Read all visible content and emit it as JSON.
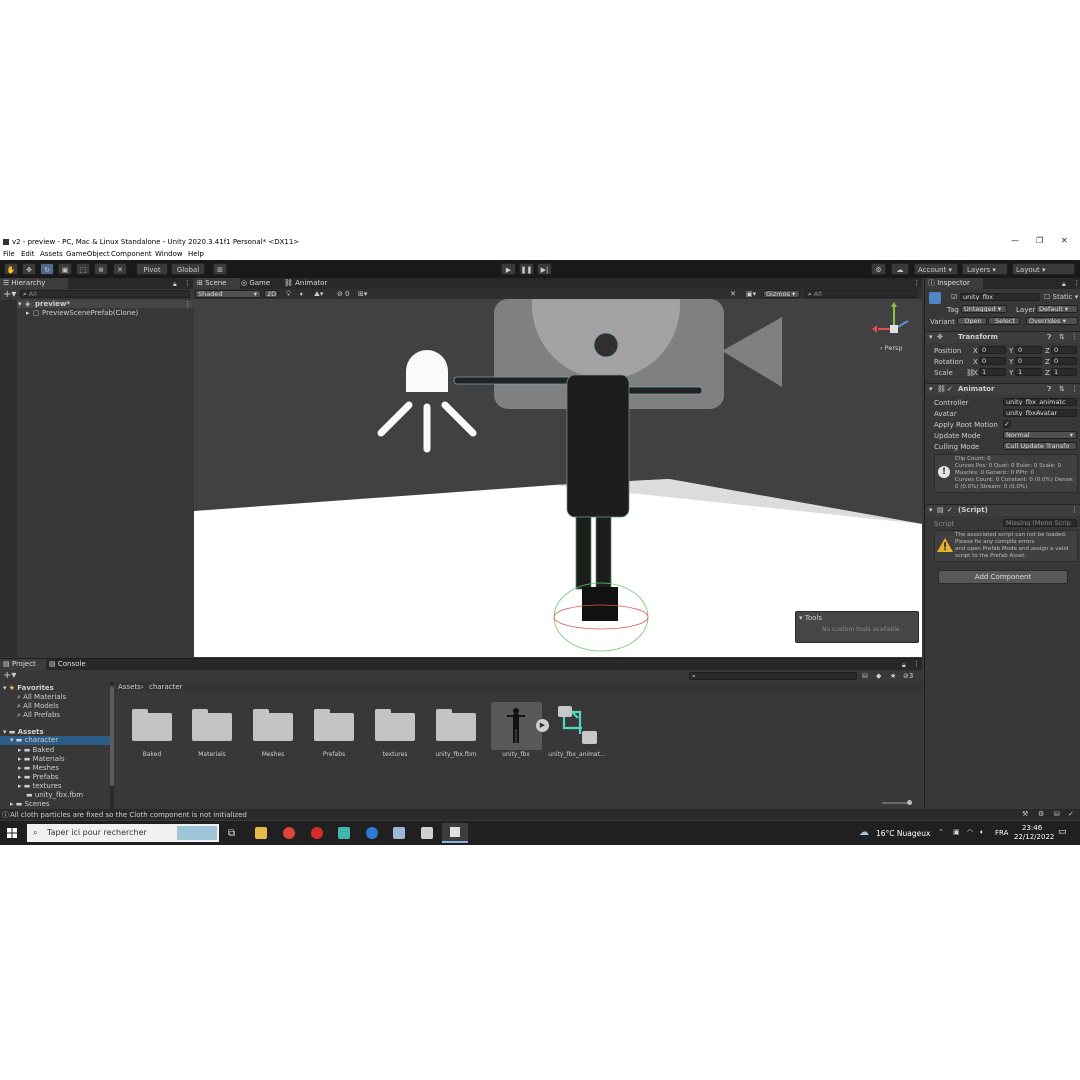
{
  "window": {
    "title": "v2 - preview - PC, Mac & Linux Standalone - Unity 2020.3.41f1 Personal* <DX11>",
    "controls": [
      "—",
      "❐",
      "✕"
    ]
  },
  "menu": [
    "File",
    "Edit",
    "Assets",
    "GameObject",
    "Component",
    "Window",
    "Help"
  ],
  "toolbar": {
    "pivot_label": "Pivot",
    "global_label": "Global",
    "account_label": "Account",
    "layers_label": "Layers",
    "layout_label": "Layout"
  },
  "hierarchy": {
    "tab": "Hierarchy",
    "search_placeholder": "All",
    "scene_name": "preview*",
    "child": "PreviewScenePrefab(Clone)"
  },
  "scene": {
    "tabs": [
      "Scene",
      "Game",
      "Animator"
    ],
    "shading": "Shaded",
    "mode2d": "2D",
    "fx_count": "0",
    "gizmos_label": "Gizmos",
    "search_placeholder": "All",
    "persp_label": "Persp",
    "tools_overlay_title": "Tools",
    "tools_overlay_text": "No custom tools available"
  },
  "inspector": {
    "tab": "Inspector",
    "object_name": "unity_fbx",
    "static_label": "Static",
    "tag_label": "Tag",
    "tag_value": "Untagged",
    "layer_label": "Layer",
    "layer_value": "Default",
    "variant_label": "Variant",
    "open_label": "Open",
    "select_label": "Select",
    "overrides_label": "Overrides",
    "transform": {
      "title": "Transform",
      "position_label": "Position",
      "rotation_label": "Rotation",
      "scale_label": "Scale",
      "x": "X",
      "y": "Y",
      "z": "Z",
      "position": [
        "0",
        "0",
        "0"
      ],
      "rotation": [
        "0",
        "0",
        "0"
      ],
      "scale": [
        "1",
        "1",
        "1"
      ]
    },
    "animator": {
      "title": "Animator",
      "controller_label": "Controller",
      "controller_value": "unity_fbx_animatc",
      "avatar_label": "Avatar",
      "avatar_value": "unity_fbxAvatar",
      "root_motion_label": "Apply Root Motion",
      "update_mode_label": "Update Mode",
      "update_mode_value": "Normal",
      "culling_mode_label": "Culling Mode",
      "culling_mode_value": "Cull Update Transfo",
      "info_lines": [
        "Clip Count: 0",
        "Curves Pos: 0 Quat: 0 Euler: 0 Scale: 0",
        "Muscles: 0 Generic: 0 PPtr: 0",
        "Curves Count: 0 Constant: 0 (0.0%) Dense:",
        "0 (0.0%) Stream: 0 (0.0%)"
      ]
    },
    "script": {
      "title": "(Script)",
      "script_label": "Script",
      "script_value": "Missing (Mono Scrip",
      "warning_lines": [
        "The associated script can not be loaded.",
        "Please fix any compile errors",
        "and open Prefab Mode and assign a valid",
        "script to the Prefab Asset."
      ]
    },
    "add_component_label": "Add Component"
  },
  "project": {
    "tabs": [
      "Project",
      "Console"
    ],
    "badge": "3",
    "favorites_label": "Favorites",
    "favorites": [
      "All Materials",
      "All Models",
      "All Prefabs"
    ],
    "assets_label": "Assets",
    "character_label": "character",
    "character_children": [
      "Baked",
      "Materials",
      "Meshes",
      "Prefabs",
      "textures",
      "unity_fbx.fbm"
    ],
    "scenes_label": "Scenes",
    "breadcrumb": [
      "Assets",
      "character"
    ],
    "items": [
      "Baked",
      "Materials",
      "Meshes",
      "Prefabs",
      "textures",
      "unity_fbx.fbm",
      "unity_fbx",
      "unity_fbx_animat..."
    ]
  },
  "status_bar": {
    "message": "All cloth particles are fixed so the Cloth component is not initialized"
  },
  "taskbar": {
    "search_placeholder": "Taper ici pour rechercher",
    "weather": "16°C  Nuageux",
    "language": "FRA",
    "time": "23:46",
    "date": "22/12/2022"
  }
}
